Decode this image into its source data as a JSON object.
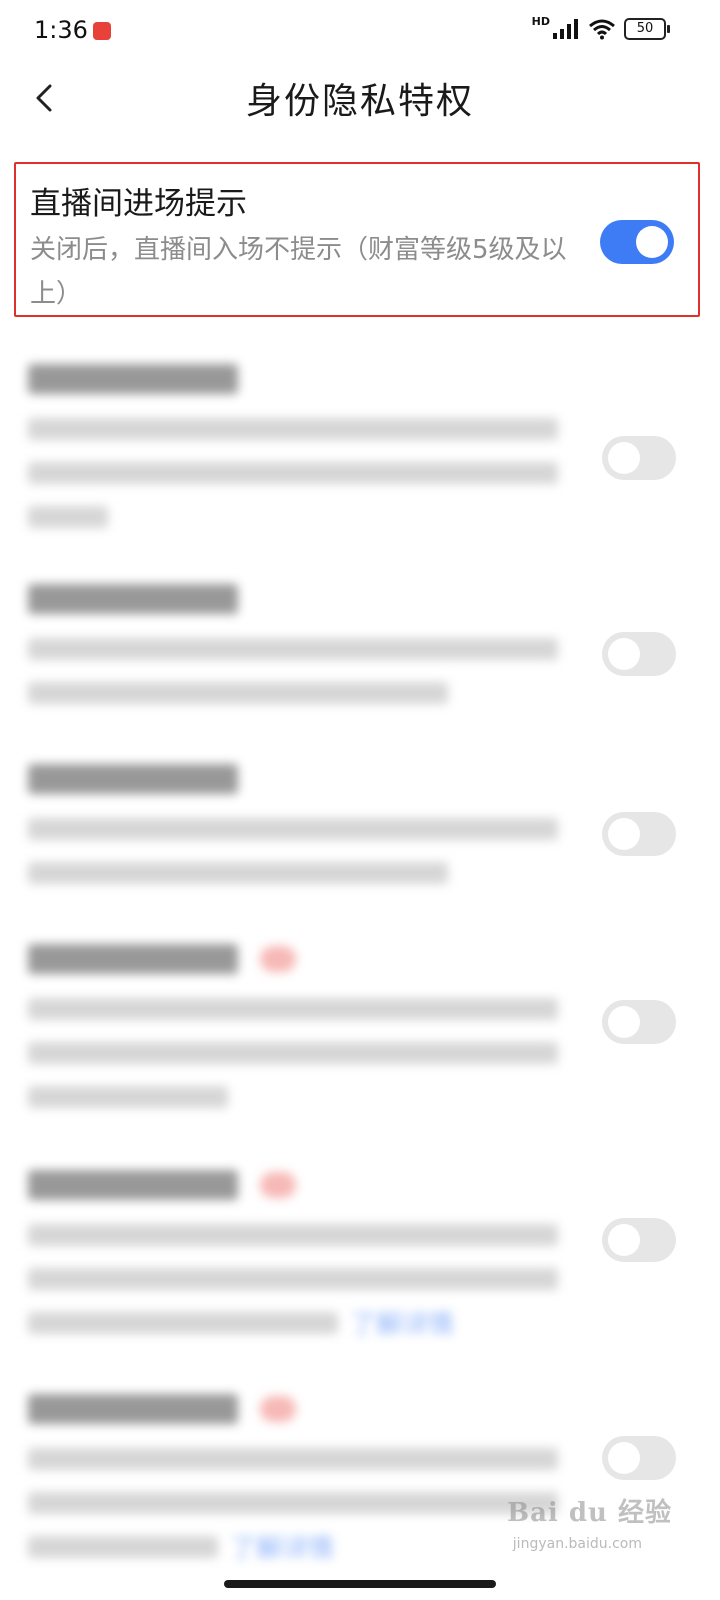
{
  "status_bar": {
    "time": "1:36",
    "network": "HD",
    "battery": "50"
  },
  "header": {
    "title": "身份隐私特权"
  },
  "settings": [
    {
      "title": "直播间进场提示",
      "description": "关闭后，直播间入场不提示（财富等级5级及以上）",
      "enabled": true,
      "highlighted": true
    },
    {
      "enabled": false,
      "blurred": true
    },
    {
      "enabled": false,
      "blurred": true
    },
    {
      "enabled": false,
      "blurred": true
    },
    {
      "enabled": false,
      "blurred": true,
      "badge": "hot"
    },
    {
      "enabled": false,
      "blurred": true,
      "badge": "hot",
      "link": "了解详情"
    },
    {
      "enabled": false,
      "blurred": true,
      "badge": "hot",
      "link": "了解详情"
    }
  ],
  "watermark": {
    "brand": "Bai du 经验",
    "url": "jingyan.baidu.com"
  },
  "colors": {
    "accent": "#3d7cf5",
    "highlight_border": "#e0302b",
    "toggle_off": "#e6e6e6",
    "description_text": "#8c8c8c"
  }
}
